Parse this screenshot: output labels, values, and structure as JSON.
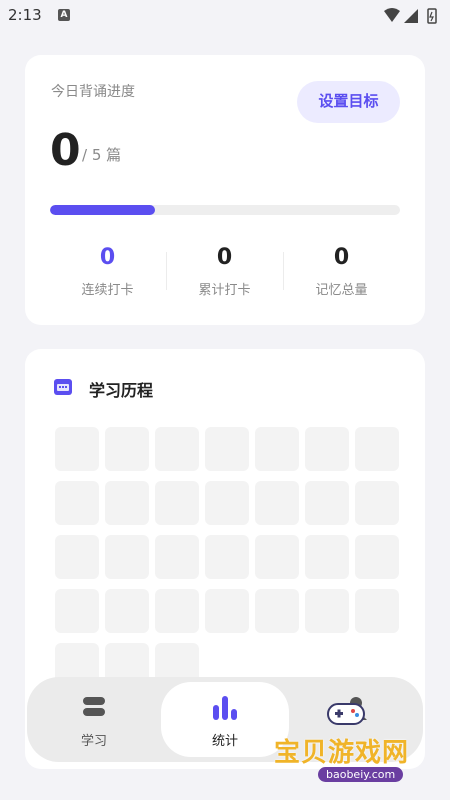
{
  "status_bar": {
    "time": "2:13",
    "indicator": "A"
  },
  "progress_card": {
    "title": "今日背诵进度",
    "goal_button": "设置目标",
    "count": "0",
    "total": "/ 5 篇",
    "progress_fraction": 0.3,
    "stats": [
      {
        "value": "0",
        "label": "连续打卡"
      },
      {
        "value": "0",
        "label": "累计打卡"
      },
      {
        "value": "0",
        "label": "记忆总量"
      }
    ]
  },
  "history_card": {
    "title": "学习历程",
    "icon": "calendar-icon"
  },
  "nav": {
    "items": [
      {
        "label": "学习",
        "icon": "stack-icon"
      },
      {
        "label": "统计",
        "icon": "bar-chart-icon"
      },
      {
        "label": "",
        "icon": "user-icon"
      }
    ],
    "active_index": 1
  },
  "watermark": {
    "text": "宝贝游戏网",
    "url": "baobeiy.com"
  },
  "colors": {
    "accent": "#5b4ef0",
    "background": "#f3f3f7",
    "card": "#ffffff"
  }
}
